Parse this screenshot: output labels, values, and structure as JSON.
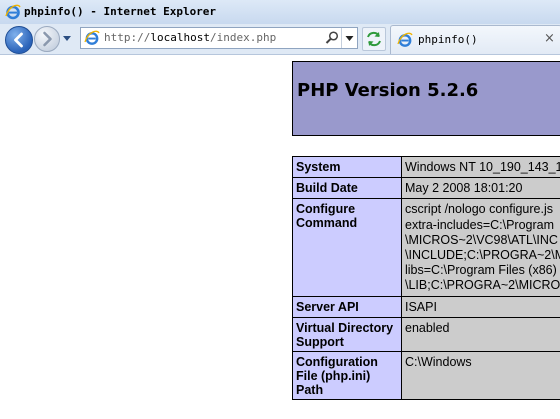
{
  "window": {
    "title": "phpinfo() - Internet Explorer"
  },
  "navigation": {
    "address_prefix": "http://",
    "address_host": "localhost",
    "address_path": "/index.php"
  },
  "tab": {
    "label": "phpinfo()",
    "close": "×"
  },
  "page": {
    "header": "PHP Version 5.2.6",
    "rows": [
      {
        "label": "System",
        "value": [
          "Windows NT 10_190_143_1"
        ]
      },
      {
        "label": "Build Date",
        "value": [
          "May 2 2008 18:01:20"
        ]
      },
      {
        "label": "Configure Command",
        "value": [
          "cscript /nologo configure.js",
          "extra-includes=C:\\Program",
          "\\MICROS~2\\VC98\\ATL\\INC",
          "\\INCLUDE;C:\\PROGRA~2\\M",
          "libs=C:\\Program Files (x86)",
          "\\LIB;C:\\PROGRA~2\\MICRO"
        ]
      },
      {
        "label": "Server API",
        "value": [
          "ISAPI"
        ]
      },
      {
        "label": "Virtual Directory Support",
        "value": [
          "enabled"
        ]
      },
      {
        "label": "Configuration File (php.ini) Path",
        "value": [
          "C:\\Windows"
        ]
      }
    ]
  }
}
